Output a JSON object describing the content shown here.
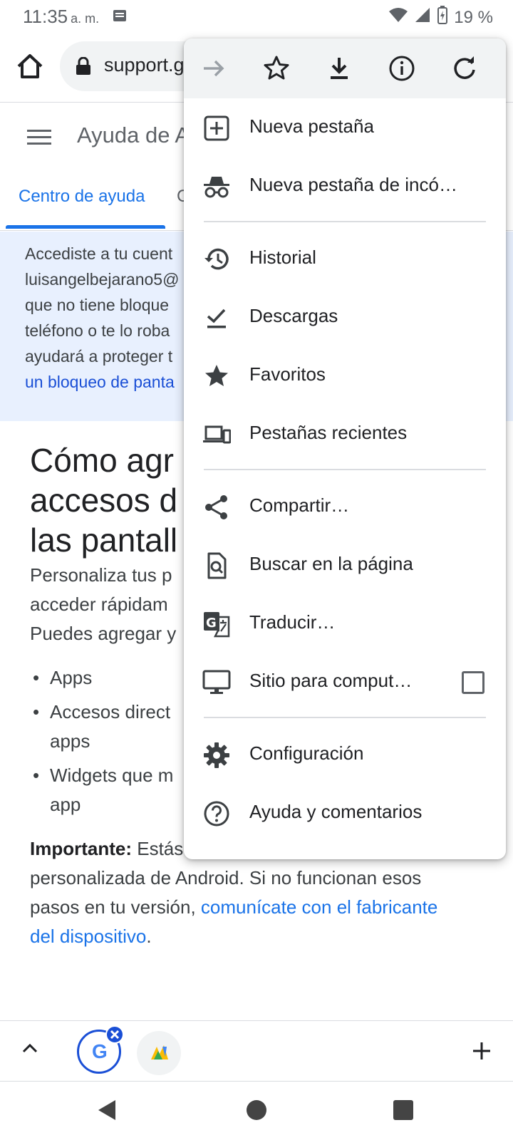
{
  "status_bar": {
    "time": "11:35",
    "ampm": "a. m.",
    "battery": "19 %"
  },
  "toolbar": {
    "url": "support.g"
  },
  "page_header": {
    "title": "Ayuda de A",
    "tab_active": "Centro de ayuda",
    "tab_other": "C"
  },
  "banner": {
    "lines": [
      "Accediste a tu cuent",
      "luisangelbejarano5@",
      "que no tiene bloque",
      "teléfono o te lo roba",
      "ayudará a proteger t"
    ],
    "link": "un bloqueo de panta"
  },
  "article": {
    "title_lines": [
      "Cómo agr",
      "accesos d",
      "las pantall"
    ],
    "intro_lines": [
      "Personaliza tus p",
      "acceder rápidam",
      "Puedes agregar y"
    ],
    "bullet_mark": "•",
    "bullets": [
      [
        "Apps"
      ],
      [
        "Accesos direct",
        "apps"
      ],
      [
        "Widgets que m",
        "app"
      ]
    ],
    "important_label": "Importante:",
    "important_line1": " Estás usando una versión",
    "important_line2": "personalizada de Android. Si no funcionan esos",
    "important_line3_prefix": "pasos en tu versión, ",
    "important_link1": "comunícate con el fabricante",
    "important_link2": "del dispositivo",
    "important_end": "."
  },
  "menu": {
    "top_icons": [
      "forward-icon",
      "star-outline-icon",
      "download-icon",
      "info-icon",
      "reload-icon"
    ],
    "items": [
      {
        "label": "Nueva pestaña",
        "icon": "new-tab-icon"
      },
      {
        "label": "Nueva pestaña de incó…",
        "icon": "incognito-icon"
      },
      {
        "label": "Historial",
        "icon": "history-icon"
      },
      {
        "label": "Descargas",
        "icon": "downloads-check-icon"
      },
      {
        "label": "Favoritos",
        "icon": "star-filled-icon"
      },
      {
        "label": "Pestañas recientes",
        "icon": "devices-icon"
      },
      {
        "label": "Compartir…",
        "icon": "share-icon"
      },
      {
        "label": "Buscar en la página",
        "icon": "find-in-page-icon"
      },
      {
        "label": "Traducir…",
        "icon": "translate-icon"
      },
      {
        "label": "Sitio para comput…",
        "icon": "desktop-icon",
        "checked": false
      },
      {
        "label": "Configuración",
        "icon": "gear-icon"
      },
      {
        "label": "Ayuda y comentarios",
        "icon": "help-icon"
      }
    ]
  },
  "tabstrip": {
    "tab1_glyph": "G"
  },
  "colors": {
    "accent": "#1a73e8",
    "banner_bg": "#e8f0fe",
    "menu_top_bg": "#f1f3f4"
  }
}
